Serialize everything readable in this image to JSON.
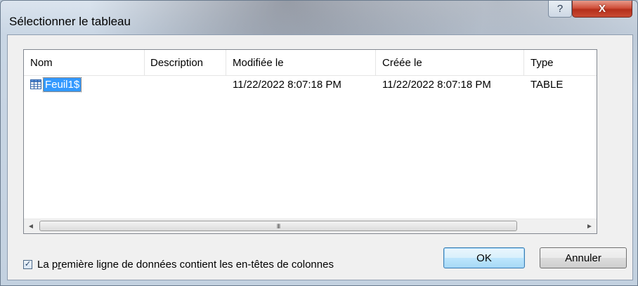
{
  "window": {
    "title": "Sélectionner le tableau",
    "help_glyph": "?",
    "close_glyph": "X"
  },
  "list": {
    "columns": [
      "Nom",
      "Description",
      "Modifiée le",
      "Créée le",
      "Type"
    ],
    "rows": [
      {
        "icon": "table-icon",
        "nom": "Feuil1$",
        "description": "",
        "modifiee_le": "11/22/2022 8:07:18 PM",
        "creee_le": "11/22/2022 8:07:18 PM",
        "type": "TABLE",
        "selected": true
      }
    ],
    "scrollbar": {
      "left_arrow": "◄",
      "right_arrow": "►",
      "thumb_grip": "III"
    }
  },
  "options": {
    "header_checkbox": {
      "checked": true,
      "label_before": "La p",
      "label_accel": "r",
      "label_after": "emière ligne de données contient les en-têtes de colonnes"
    }
  },
  "buttons": {
    "ok": "OK",
    "cancel": "Annuler"
  },
  "colors": {
    "selection": "#3399ff",
    "close_button": "#c94a33"
  }
}
